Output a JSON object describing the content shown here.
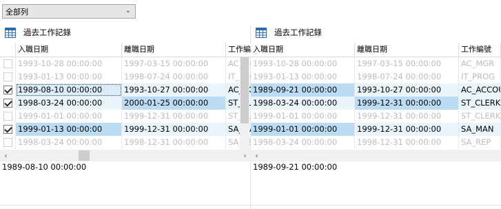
{
  "filter": {
    "selected": "全部列"
  },
  "panels": [
    {
      "title": "過去工作記錄",
      "columns": [
        "入職日期",
        "離職日期",
        "工作編號"
      ],
      "rows": [
        {
          "checked": false,
          "disabled": true,
          "cells": [
            "1993-10-28 00:00:00",
            "1997-03-15 00:00:00",
            "AC_MGR"
          ]
        },
        {
          "checked": false,
          "disabled": true,
          "cells": [
            "1993-01-13 00:00:00",
            "1998-07-24 00:00:00",
            "IT_PROG"
          ]
        },
        {
          "checked": true,
          "disabled": false,
          "cells": [
            "1989-08-10 00:00:00",
            "1993-10-27 00:00:00",
            "AC_ACCOUNT"
          ]
        },
        {
          "checked": true,
          "disabled": false,
          "cells": [
            "1998-03-24 00:00:00",
            "2000-01-25 00:00:00",
            "ST_CLERK"
          ]
        },
        {
          "checked": false,
          "disabled": true,
          "cells": [
            "1999-01-01 00:00:00",
            "1999-12-31 00:00:00",
            "ST_CLERK"
          ]
        },
        {
          "checked": true,
          "disabled": false,
          "cells": [
            "1999-01-13 00:00:00",
            "1999-12-31 00:00:00",
            "SA_MAN"
          ]
        },
        {
          "checked": false,
          "disabled": true,
          "cells": [
            "1998-03-24 00:00:00",
            "1998-12-31 00:00:00",
            "SA_REP"
          ]
        }
      ],
      "detail": "1989-08-10 00:00:00"
    },
    {
      "title": "過去工作記錄",
      "columns": [
        "入職日期",
        "離職日期",
        "工作編號"
      ],
      "rows": [
        {
          "disabled": true,
          "cells": [
            "1993-10-28 00:00:00",
            "1997-03-15 00:00:00",
            "AC_MGR"
          ]
        },
        {
          "disabled": true,
          "cells": [
            "1993-01-13 00:00:00",
            "1998-07-24 00:00:00",
            "IT_PROG"
          ]
        },
        {
          "disabled": false,
          "cells": [
            "1989-09-21 00:00:00",
            "1993-10-27 00:00:00",
            "AC_ACCOUNT"
          ]
        },
        {
          "disabled": false,
          "cells": [
            "1998-03-24 00:00:00",
            "1999-12-31 00:00:00",
            "ST_CLERK"
          ]
        },
        {
          "disabled": true,
          "cells": [
            "1999-01-01 00:00:00",
            "1999-12-31 00:00:00",
            "ST_CLERK"
          ]
        },
        {
          "disabled": false,
          "cells": [
            "1999-01-01 00:00:00",
            "1999-12-31 00:00:00",
            "SA_MAN"
          ]
        },
        {
          "disabled": true,
          "cells": [
            "1998-03-24 00:00:00",
            "1998-12-31 00:00:00",
            "SA_REP"
          ]
        }
      ],
      "detail": "1989-09-21 00:00:00"
    }
  ],
  "icons": {
    "table": "table-icon",
    "dropdown": "chevron-down-icon",
    "scroll_left": "scroll-left-icon",
    "scroll_right": "scroll-right-icon"
  },
  "colors": {
    "selection": "#cfe6f7",
    "disabled_text": "#bdbdbd",
    "grid_line": "#dcdcdc"
  }
}
